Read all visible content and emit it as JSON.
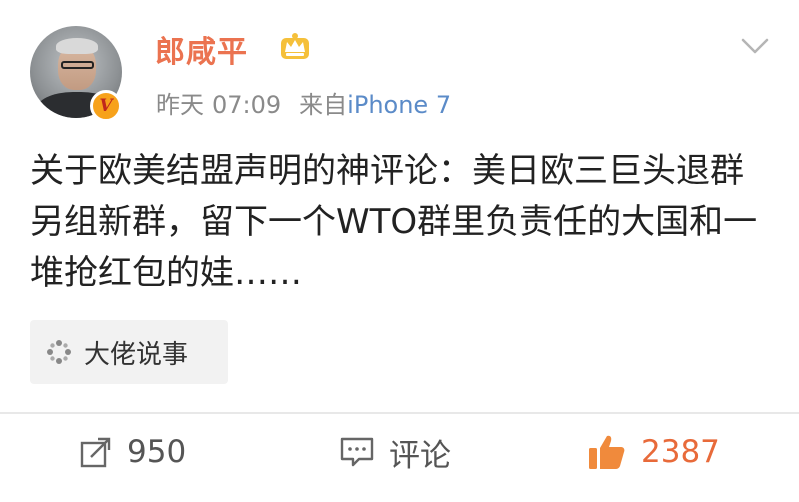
{
  "post": {
    "author": {
      "name": "郎咸平",
      "avatar_icon": "avatar-photo",
      "verified_icon": "verified-v-badge",
      "member_icon": "crown-icon",
      "verified_letter": "V"
    },
    "meta": {
      "day": "昨天",
      "time": "07:09",
      "source_label": "来自",
      "source": "iPhone 7"
    },
    "menu_icon": "chevron-down-icon",
    "text": "关于欧美结盟声明的神评论：美日欧三巨头退群另组新群，留下一个WTO群里负责任的大国和一堆抢红包的娃……",
    "topic_tag": {
      "icon": "dots-icon",
      "label": "大佬说事"
    },
    "actions": {
      "repost": {
        "icon": "repost-icon",
        "count": "950"
      },
      "comment": {
        "icon": "comment-icon",
        "label": "评论"
      },
      "like": {
        "icon": "thumbs-up-icon",
        "count": "2387"
      }
    },
    "colors": {
      "username": "#eb7350",
      "link": "#5b8bc8",
      "like": "#e86a3a",
      "meta": "#8a8a8a"
    }
  }
}
